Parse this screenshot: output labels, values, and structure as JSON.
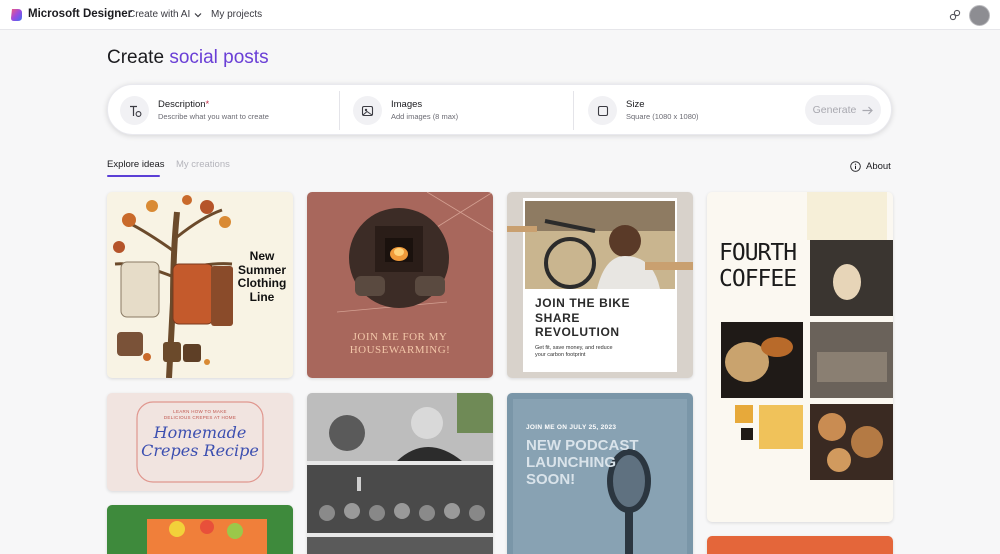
{
  "header": {
    "brand": "Microsoft Designer",
    "create_with_ai": "Create with AI",
    "my_projects": "My projects"
  },
  "page": {
    "title_plain": "Create",
    "title_accent": "social posts"
  },
  "prompt": {
    "description_label": "Description",
    "description_required": "*",
    "description_hint": "Describe what you want to create",
    "images_label": "Images",
    "images_hint": "Add images (8 max)",
    "size_label": "Size",
    "size_value": "Square (1080 x 1080)",
    "generate_label": "Generate"
  },
  "tabs": {
    "explore": "Explore ideas",
    "creations": "My creations",
    "about": "About"
  },
  "cards": {
    "clothing": "New\nSummer\nClothing\nLine",
    "housewarming": "JOIN ME FOR MY\nHOUSEWARMING!",
    "bike_title": "JOIN THE BIKE\nSHARE\nREVOLUTION",
    "bike_sub": "Get fit, save money, and reduce\nyour carbon footprint",
    "coffee": "FOURTH\nCOFFEE",
    "crepes_small": "LEARN HOW TO MAKE\nDELICIOUS CREPES AT HOME",
    "crepes_title": "Homemade\nCrepes Recipe",
    "podcast_date": "JOIN ME ON JULY 25, 2023",
    "podcast_title": "NEW PODCAST\nLAUNCHING\nSOON!"
  },
  "colors": {
    "accent": "#6a3fd6",
    "tab_underline": "#5b3fd6",
    "required": "#c4314b"
  }
}
